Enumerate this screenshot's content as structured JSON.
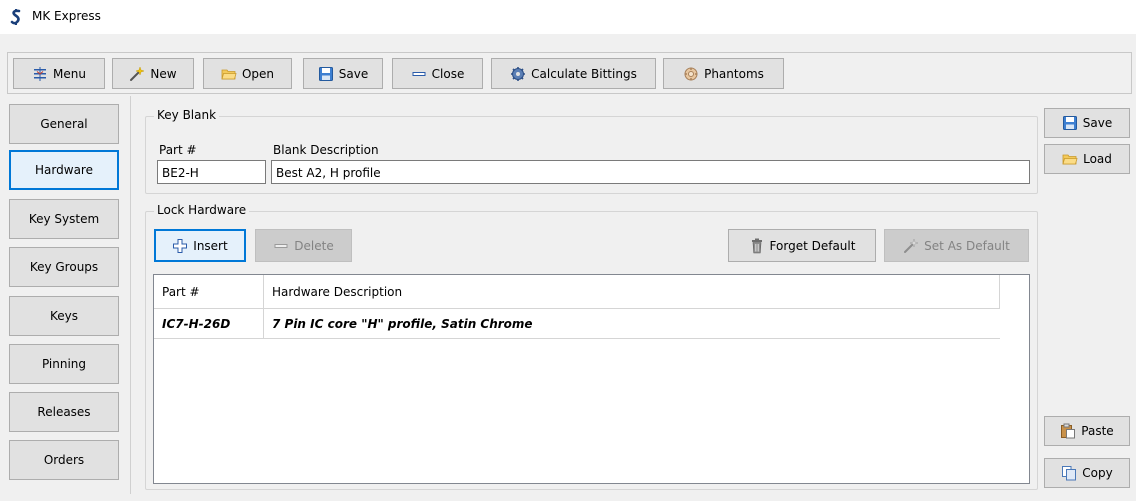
{
  "window": {
    "title": "MK Express"
  },
  "toolbar": {
    "menu": "Menu",
    "new": "New",
    "open": "Open",
    "save": "Save",
    "close": "Close",
    "calculate_bittings": "Calculate Bittings",
    "phantoms": "Phantoms"
  },
  "nav": {
    "items": [
      {
        "label": "General"
      },
      {
        "label": "Hardware"
      },
      {
        "label": "Key System"
      },
      {
        "label": "Key Groups"
      },
      {
        "label": "Keys"
      },
      {
        "label": "Pinning"
      },
      {
        "label": "Releases"
      },
      {
        "label": "Orders"
      }
    ],
    "selected": "Hardware"
  },
  "key_blank": {
    "title": "Key Blank",
    "part_label": "Part #",
    "part_value": "BE2-H",
    "desc_label": "Blank Description",
    "desc_value": "Best A2, H profile"
  },
  "lock_hardware": {
    "title": "Lock Hardware",
    "insert": "Insert",
    "delete": "Delete",
    "forget_default": "Forget Default",
    "set_as_default": "Set As Default",
    "table": {
      "columns": [
        "Part #",
        "Hardware Description"
      ],
      "rows": [
        [
          "IC7-H-26D",
          "7 Pin IC core \"H\" profile, Satin Chrome"
        ]
      ]
    }
  },
  "side": {
    "save": "Save",
    "load": "Load",
    "paste": "Paste",
    "copy": "Copy"
  },
  "colors": {
    "focus": "#0078d7",
    "button_face": "#e1e1e1",
    "disabled_text": "#838383"
  }
}
